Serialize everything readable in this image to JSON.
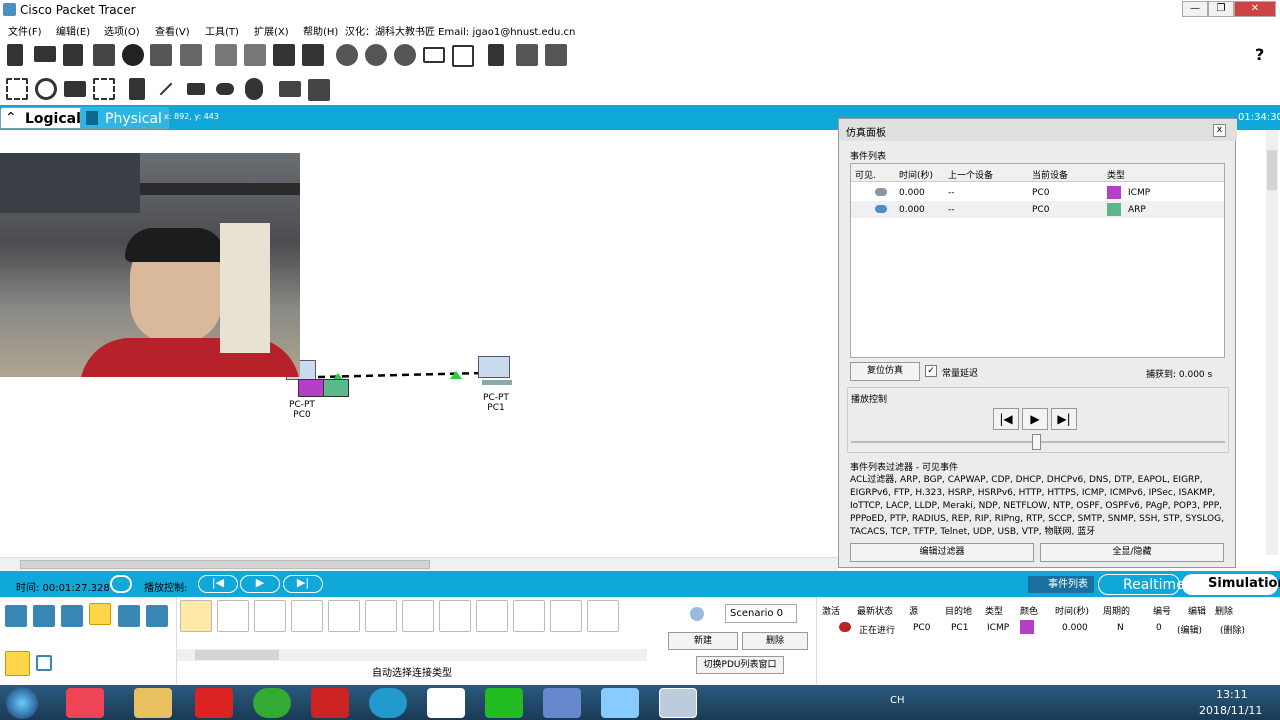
{
  "window": {
    "title": "Cisco Packet Tracer",
    "buttons": [
      "—",
      "❐",
      "✕"
    ]
  },
  "menu": [
    "文件(F)",
    "编辑(E)",
    "选项(O)",
    "查看(V)",
    "工具(T)",
    "扩展(X)",
    "帮助(H)",
    "汉化：湖科大教书匠  Email: jgao1@hnust.edu.cn"
  ],
  "help_icon": "?",
  "workspace": {
    "logical_label": "Logical",
    "physical_label": "Physical",
    "coords": "x: 892, y: 443",
    "time_display": "01:34:30"
  },
  "devices": [
    {
      "type": "PC-PT",
      "name": "PC0"
    },
    {
      "type": "PC-PT",
      "name": "PC1"
    }
  ],
  "sim_panel": {
    "title": "仿真面板",
    "close": "x",
    "event_list_label": "事件列表",
    "headers": [
      "可见.",
      "时间(秒)",
      "上一个设备",
      "当前设备",
      "类型"
    ],
    "events": [
      {
        "time": "0.000",
        "last": "--",
        "current": "PC0",
        "type": "ICMP",
        "color": "#b540c8"
      },
      {
        "time": "0.000",
        "last": "--",
        "current": "PC0",
        "type": "ARP",
        "color": "#5cb88c"
      }
    ],
    "reset_btn": "复位仿真",
    "const_delay": "常量延迟",
    "captured": "捕获到:  0.000 s",
    "playback_label": "播放控制",
    "filter_label": "事件列表过滤器 - 可见事件",
    "filter_text": "ACL过滤器, ARP, BGP, CAPWAP, CDP, DHCP, DHCPv6, DNS, DTP, EAPOL, EIGRP, EIGRPv6, FTP, H.323, HSRP, HSRPv6, HTTP, HTTPS, ICMP, ICMPv6, IPSec, ISAKMP, IoTTCP, LACP, LLDP, Meraki, NDP, NETFLOW, NTP, OSPF, OSPFv6, PAgP, POP3, PPP, PPPoED, PTP, RADIUS, REP, RIP, RIPng, RTP, SCCP, SMTP, SNMP, SSH, STP, SYSLOG, TACACS, TCP, TFTP, Telnet, UDP, USB, VTP, 物联网, 蓝牙",
    "edit_filter_btn": "编辑过滤器",
    "show_all_btn": "全显/隐藏"
  },
  "status": {
    "time": "时间: 00:01:27.328",
    "play_label": "播放控制:",
    "event_list_btn": "事件列表",
    "realtime": "Realtime",
    "simulation": "Simulation"
  },
  "bottom": {
    "auto_conn": "自动选择连接类型",
    "scenario": "Scenario 0",
    "new_btn": "新建",
    "delete_btn": "删除",
    "toggle_pdu_btn": "切换PDU列表窗口",
    "pdu_headers": [
      "激活",
      "最新状态",
      "源",
      "目的地",
      "类型",
      "颜色",
      "时间(秒)",
      "周期的",
      "编号",
      "编辑",
      "删除"
    ],
    "pdu_row": {
      "status": "正在进行",
      "src": "PC0",
      "dst": "PC1",
      "type": "ICMP",
      "color": "#b540c8",
      "time": "0.000",
      "periodic": "N",
      "num": "0",
      "edit": "(编辑)",
      "del": "(删除)"
    }
  },
  "taskbar": {
    "time": "13:11",
    "date": "2018/11/11",
    "ime": "CH"
  }
}
